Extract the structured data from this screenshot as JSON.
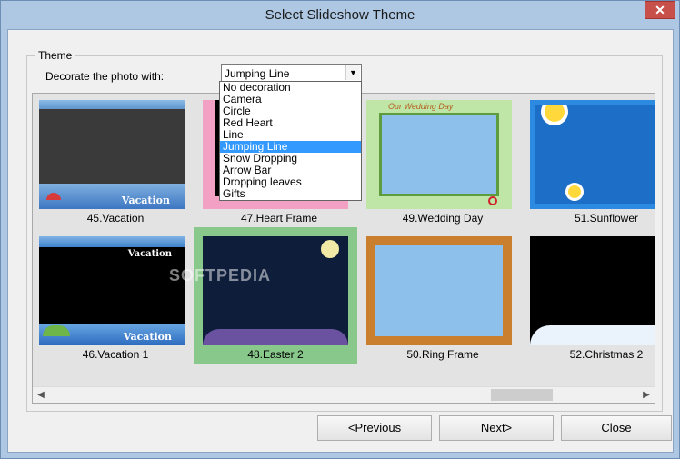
{
  "window": {
    "title": "Select Slideshow Theme",
    "close_label": "✕"
  },
  "theme_group": {
    "legend": "Theme",
    "decorate_label": "Decorate the photo with:",
    "selected_decoration": "Jumping Line",
    "dropdown_options": [
      "No decoration",
      "Camera",
      "Circle",
      "Red Heart",
      "Line",
      "Jumping Line",
      "Snow Dropping",
      "Arrow Bar",
      "Dropping leaves",
      "Gifts"
    ],
    "dropdown_active_index": 5
  },
  "gallery": {
    "tiles": [
      {
        "label": "45.Vacation",
        "thumb_text": "Vacation",
        "selected": false
      },
      {
        "label": "47.Heart Frame",
        "selected": false
      },
      {
        "label": "49.Wedding Day",
        "thumb_text": "Our Wedding Day",
        "selected": false
      },
      {
        "label": "51.Sunflower",
        "selected": false
      },
      {
        "label": "46.Vacation 1",
        "thumb_text": "Vacation",
        "selected": false
      },
      {
        "label": "48.Easter 2",
        "selected": true
      },
      {
        "label": "50.Ring Frame",
        "selected": false
      },
      {
        "label": "52.Christmas 2",
        "selected": false
      }
    ],
    "watermark": "SOFTPEDIA"
  },
  "buttons": {
    "previous": "<Previous",
    "next": "Next>",
    "close": "Close"
  },
  "icons": {
    "dropdown_arrow": "chevron-down-icon",
    "scroll_left": "chevron-left-icon",
    "scroll_right": "chevron-right-icon"
  },
  "colors": {
    "titlebar": "#aec8e4",
    "close_button": "#c7504a",
    "selected_tile": "#88c88a",
    "highlight": "#3399ff"
  }
}
